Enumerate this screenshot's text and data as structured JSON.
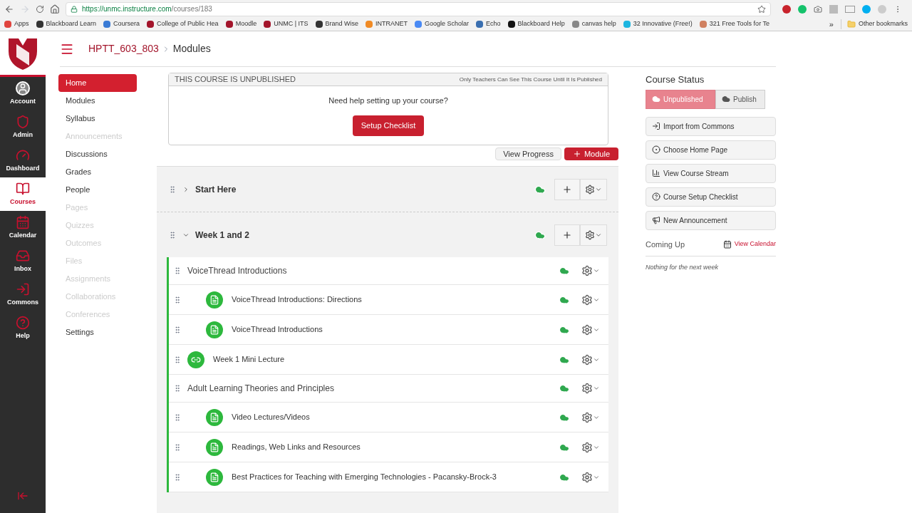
{
  "browser": {
    "url_host": "https://unmc.instructure.com",
    "url_path": "/courses/183",
    "bookmarks": [
      {
        "label": "Apps",
        "color": "#e0443e"
      },
      {
        "label": "Blackboard Learn",
        "color": "#333333"
      },
      {
        "label": "Coursera",
        "color": "#3a7bd5"
      },
      {
        "label": "College of Public Hea",
        "color": "#a3152b"
      },
      {
        "label": "Moodle",
        "color": "#a3152b"
      },
      {
        "label": "UNMC | ITS",
        "color": "#a3152b"
      },
      {
        "label": "Brand Wise",
        "color": "#333333"
      },
      {
        "label": "INTRANET",
        "color": "#f08a24"
      },
      {
        "label": "Google Scholar",
        "color": "#4a8af4"
      },
      {
        "label": "Echo",
        "color": "#3a6fb0"
      },
      {
        "label": "Blackboard Help",
        "color": "#111111"
      },
      {
        "label": "canvas help",
        "color": "#888888"
      },
      {
        "label": "32 Innovative (Free!)",
        "color": "#1cb5e0"
      },
      {
        "label": "321 Free Tools for Te",
        "color": "#d08060"
      }
    ],
    "overflow": "»",
    "other": "Other bookmarks"
  },
  "global_nav": [
    {
      "label": "Account",
      "kind": "avatar",
      "selected": false
    },
    {
      "label": "Admin",
      "kind": "shield",
      "selected": false
    },
    {
      "label": "Dashboard",
      "kind": "gauge",
      "selected": false
    },
    {
      "label": "Courses",
      "kind": "book",
      "selected": true
    },
    {
      "label": "Calendar",
      "kind": "calendar",
      "selected": false
    },
    {
      "label": "Inbox",
      "kind": "inbox",
      "selected": false
    },
    {
      "label": "Commons",
      "kind": "share",
      "selected": false
    },
    {
      "label": "Help",
      "kind": "help",
      "selected": false
    }
  ],
  "breadcrumb": [
    "HPTT_603_803",
    "Modules"
  ],
  "course_nav": [
    {
      "label": "Home",
      "selected": true,
      "hidden": false
    },
    {
      "label": "Modules",
      "selected": false,
      "hidden": false
    },
    {
      "label": "Syllabus",
      "selected": false,
      "hidden": false
    },
    {
      "label": "Announcements",
      "selected": false,
      "hidden": true
    },
    {
      "label": "Discussions",
      "selected": false,
      "hidden": false
    },
    {
      "label": "Grades",
      "selected": false,
      "hidden": false
    },
    {
      "label": "People",
      "selected": false,
      "hidden": false
    },
    {
      "label": "Pages",
      "selected": false,
      "hidden": true
    },
    {
      "label": "Quizzes",
      "selected": false,
      "hidden": true
    },
    {
      "label": "Outcomes",
      "selected": false,
      "hidden": true
    },
    {
      "label": "Files",
      "selected": false,
      "hidden": true
    },
    {
      "label": "Assignments",
      "selected": false,
      "hidden": true
    },
    {
      "label": "Collaborations",
      "selected": false,
      "hidden": true
    },
    {
      "label": "Conferences",
      "selected": false,
      "hidden": true
    },
    {
      "label": "Settings",
      "selected": false,
      "hidden": false
    }
  ],
  "notice": {
    "title": "THIS COURSE IS UNPUBLISHED",
    "note": "Only Teachers Can See This Course Until It Is Published",
    "question": "Need help setting up your course?",
    "button": "Setup Checklist"
  },
  "toolbar": {
    "view_progress": "View Progress",
    "add_module": "Module"
  },
  "modules": [
    {
      "title": "Start Here",
      "expanded": false,
      "published": true
    },
    {
      "title": "Week 1 and 2",
      "expanded": true,
      "published": true,
      "items": [
        {
          "kind": "subheader",
          "title": "VoiceThread Introductions",
          "published": true,
          "children": [
            {
              "kind": "page",
              "title": "VoiceThread Introductions: Directions",
              "published": true
            },
            {
              "kind": "page",
              "title": "VoiceThread Introductions",
              "published": true
            }
          ]
        },
        {
          "kind": "link",
          "title": "Week 1 Mini Lecture",
          "published": true
        },
        {
          "kind": "subheader",
          "title": "Adult Learning Theories and Principles",
          "published": true,
          "children": [
            {
              "kind": "page",
              "title": "Video Lectures/Videos",
              "published": true
            },
            {
              "kind": "page",
              "title": "Readings, Web Links and Resources",
              "published": true
            },
            {
              "kind": "page",
              "title": "Best Practices for Teaching with Emerging Technologies - Pacansky-Brock-3",
              "published": true
            }
          ]
        }
      ]
    }
  ],
  "sidebar": {
    "status_title": "Course Status",
    "status": [
      {
        "label": "Unpublished",
        "selected": true
      },
      {
        "label": "Publish",
        "selected": false
      }
    ],
    "actions": [
      {
        "label": "Import from Commons",
        "kind": "share"
      },
      {
        "label": "Choose Home Page",
        "kind": "target"
      },
      {
        "label": "View Course Stream",
        "kind": "bars"
      },
      {
        "label": "Course Setup Checklist",
        "kind": "help"
      },
      {
        "label": "New Announcement",
        "kind": "megaphone"
      }
    ],
    "coming_up": "Coming Up",
    "view_calendar": "View Calendar",
    "empty": "Nothing for the next week"
  }
}
